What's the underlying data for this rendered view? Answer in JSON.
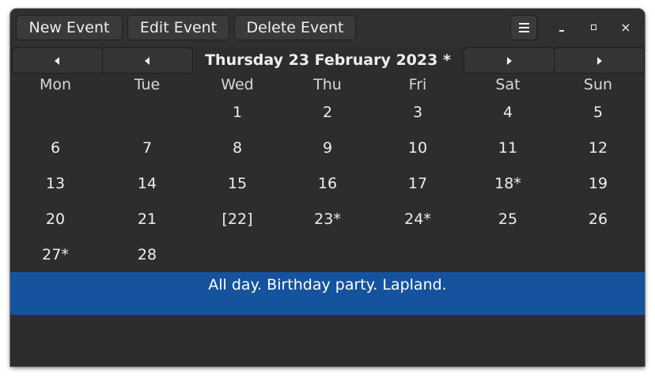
{
  "toolbar": {
    "new_event": "New Event",
    "edit_event": "Edit Event",
    "delete_event": "Delete Event"
  },
  "window_controls": {
    "close": "×"
  },
  "calendar": {
    "title": "Thursday 23 February 2023 *",
    "weekdays": [
      "Mon",
      "Tue",
      "Wed",
      "Thu",
      "Fri",
      "Sat",
      "Sun"
    ],
    "weeks": [
      [
        "",
        "",
        "1",
        "2",
        "3",
        "4",
        "5"
      ],
      [
        "6",
        "7",
        "8",
        "9",
        "10",
        "11",
        "12"
      ],
      [
        "13",
        "14",
        "15",
        "16",
        "17",
        "18*",
        "19"
      ],
      [
        "20",
        "21",
        "[22]",
        "23*",
        "24*",
        "25",
        "26"
      ],
      [
        "27*",
        "28",
        "",
        "",
        "",
        "",
        ""
      ]
    ]
  },
  "events": {
    "selected": "All day. Birthday party. Lapland."
  },
  "colors": {
    "selection": "#15539e",
    "background": "#2d2d2d"
  }
}
